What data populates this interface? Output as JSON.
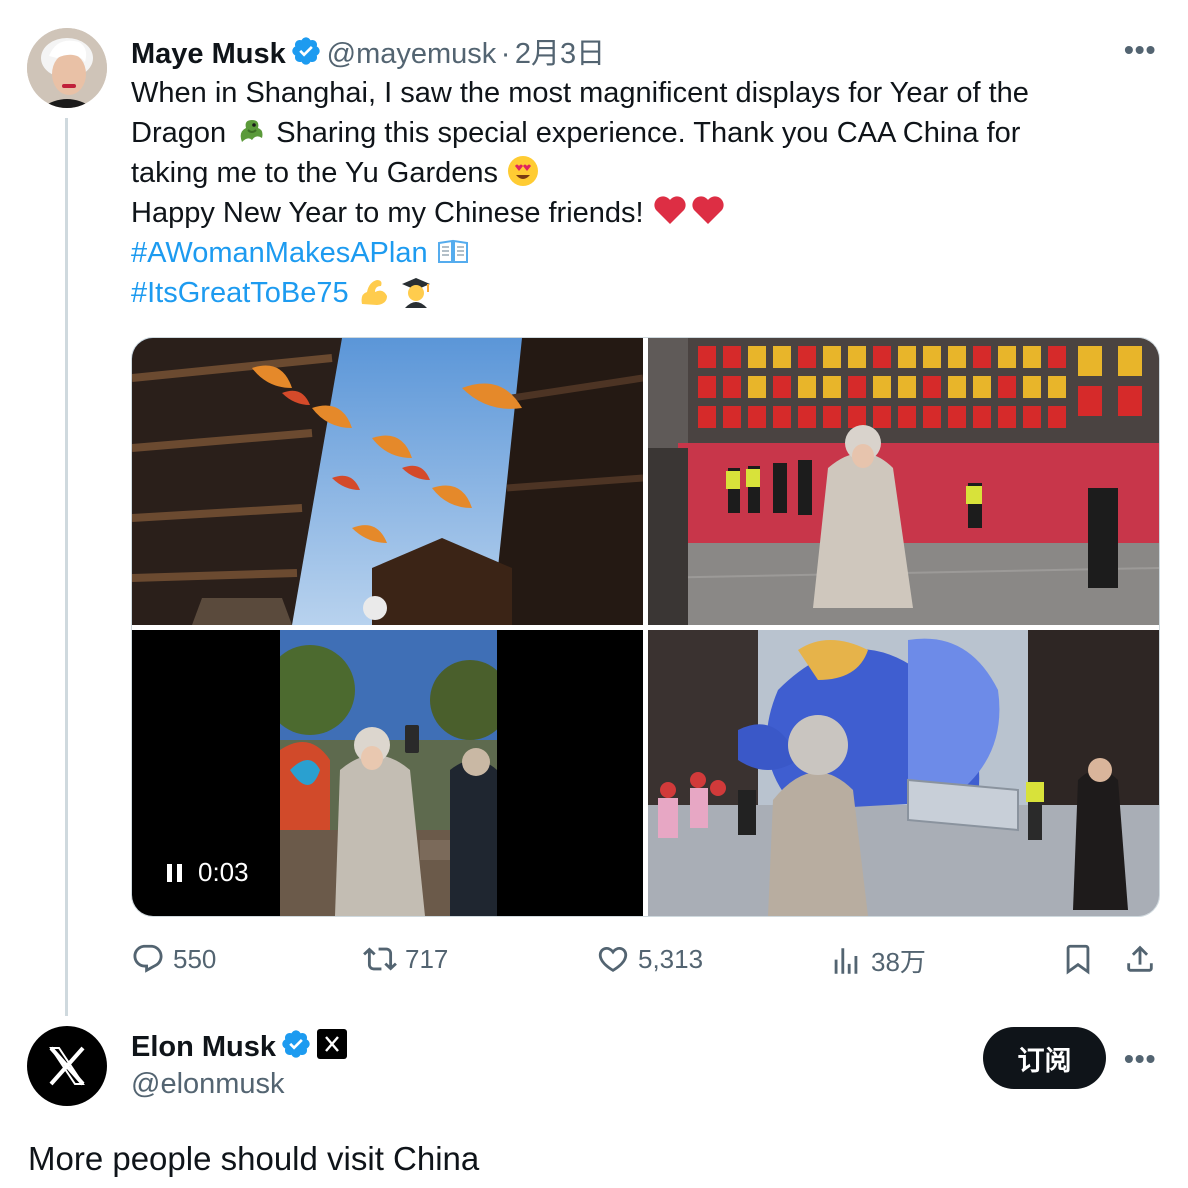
{
  "quoted_tweet": {
    "author": {
      "name": "Maye Musk",
      "handle": "@mayemusk",
      "separator": "·",
      "date": "2月3日",
      "avatar": "profile-photo"
    },
    "text_lines": [
      "When in Shanghai, I saw the most magnificent displays for Year of the",
      "Dragon",
      "Sharing this special experience. Thank you CAA China for",
      "taking me to the Yu Gardens",
      "Happy New Year to my Chinese friends!"
    ],
    "hashtags": [
      "#AWomanMakesAPlan",
      "#ItsGreatToBe75"
    ],
    "emojis": [
      "dragon-emoji",
      "heart-eyes-emoji",
      "red-heart-emoji",
      "open-book-emoji",
      "flexed-biceps-emoji",
      "graduate-emoji"
    ],
    "media": {
      "video_time": "0:03",
      "video_state": "playing",
      "photos": [
        "koi-lantern-street",
        "dragon-lantern-wall",
        "woman-filming-video",
        "blue-dragon-display"
      ]
    },
    "metrics": {
      "replies": "550",
      "reposts": "717",
      "likes": "5,313",
      "views": "38万"
    },
    "more_label": "•••"
  },
  "reply_tweet": {
    "author": {
      "name": "Elon Musk",
      "handle": "@elonmusk",
      "avatar": "x-logo",
      "badge": "X"
    },
    "follow_label": "订阅",
    "more_label": "•••",
    "text": "More people should visit China"
  },
  "colors": {
    "link": "#1d9bf0",
    "muted": "#536471",
    "verified": "#1d9bf0",
    "primary": "#0f1419",
    "border": "#cfd9de"
  }
}
